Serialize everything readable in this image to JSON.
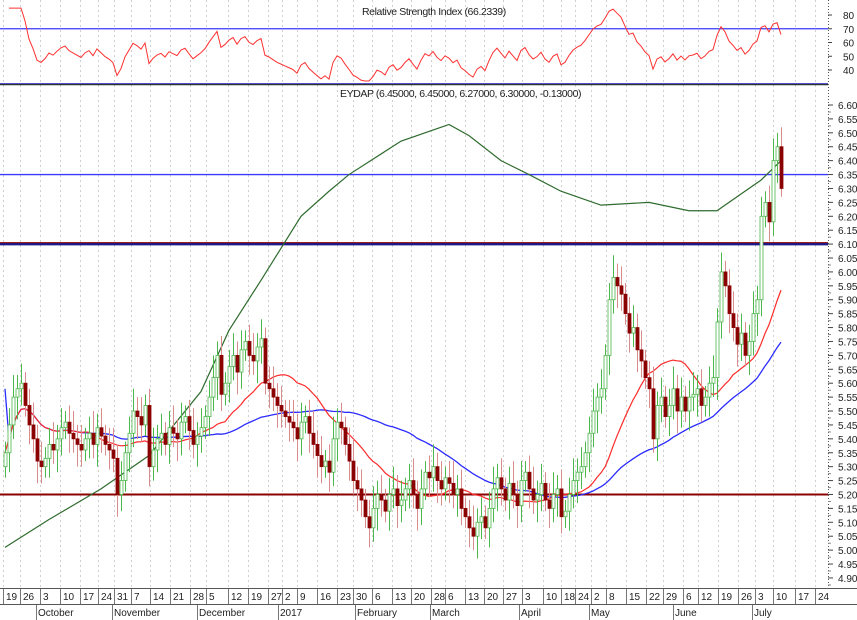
{
  "rsi_panel": {
    "title": "Relative Strength Index (66.2339)",
    "y_ticks": [
      "80",
      "70",
      "60",
      "50",
      "40"
    ]
  },
  "price_panel": {
    "title": "EYDAP (6.45000, 6.45000, 6.27000, 6.30000, -0.13000)"
  },
  "colors": {
    "up": "#4cb84c",
    "down": "#8b0000",
    "down_wick": "#d98c8c",
    "ma_short": "#ff2a2a",
    "ma_long": "#2b2bff",
    "long_line": "#2e6b2e",
    "resistance": "#3a3aff",
    "support": "#8b0000",
    "rsi": "#ff3030"
  },
  "chart_data": {
    "type": "candlestick",
    "symbol": "EYDAP",
    "title": "EYDAP (6.45000, 6.45000, 6.27000, 6.30000, -0.13000)",
    "last_bar": {
      "open": 6.45,
      "high": 6.45,
      "low": 6.27,
      "close": 6.3,
      "change": -0.13
    },
    "ylim": [
      4.9,
      6.6
    ],
    "y_ticks": [
      "6.60",
      "6.55",
      "6.50",
      "6.45",
      "6.40",
      "6.35",
      "6.30",
      "6.25",
      "6.20",
      "6.15",
      "6.10",
      "6.05",
      "6.00",
      "5.95",
      "5.90",
      "5.85",
      "5.80",
      "5.75",
      "5.70",
      "5.65",
      "5.60",
      "5.55",
      "5.50",
      "5.45",
      "5.40",
      "5.35",
      "5.30",
      "5.25",
      "5.20",
      "5.15",
      "5.10",
      "5.05",
      "5.00",
      "4.95",
      "4.90"
    ],
    "x_ticks": [
      "19",
      "26",
      "3",
      "10",
      "17",
      "24",
      "31",
      "7",
      "14",
      "21",
      "28",
      "5",
      "12",
      "19",
      "27",
      "2",
      "9",
      "16",
      "23",
      "30",
      "6",
      "13",
      "20",
      "28",
      "6",
      "13",
      "20",
      "27",
      "3",
      "10",
      "18",
      "24",
      "2",
      "8",
      "15",
      "22",
      "29",
      "6",
      "12",
      "19",
      "26",
      "3",
      "10",
      "17",
      "24"
    ],
    "months": [
      "October",
      "November",
      "December",
      "2017",
      "February",
      "March",
      "April",
      "May",
      "June",
      "July"
    ],
    "horizontal_lines": [
      {
        "value": 6.35,
        "color": "#3a3aff"
      },
      {
        "value": 6.1,
        "color": "#1a1a8b"
      },
      {
        "value": 5.2,
        "color": "#8b0000"
      }
    ],
    "rsi_levels": [
      70,
      30
    ],
    "rsi_ylim": [
      30,
      85
    ],
    "first_open": 5.3,
    "closes": [
      5.35,
      5.45,
      5.55,
      5.58,
      5.6,
      5.52,
      5.45,
      5.4,
      5.32,
      5.3,
      5.33,
      5.38,
      5.36,
      5.4,
      5.44,
      5.46,
      5.42,
      5.4,
      5.38,
      5.36,
      5.4,
      5.42,
      5.38,
      5.44,
      5.41,
      5.38,
      5.36,
      5.33,
      5.2,
      5.25,
      5.35,
      5.42,
      5.5,
      5.48,
      5.45,
      5.52,
      5.3,
      5.36,
      5.4,
      5.42,
      5.38,
      5.44,
      5.42,
      5.4,
      5.46,
      5.48,
      5.43,
      5.38,
      5.41,
      5.44,
      5.48,
      5.55,
      5.62,
      5.7,
      5.56,
      5.6,
      5.66,
      5.7,
      5.64,
      5.72,
      5.75,
      5.7,
      5.68,
      5.73,
      5.76,
      5.6,
      5.58,
      5.55,
      5.52,
      5.5,
      5.48,
      5.46,
      5.44,
      5.4,
      5.46,
      5.48,
      5.42,
      5.38,
      5.34,
      5.3,
      5.32,
      5.28,
      5.4,
      5.46,
      5.44,
      5.38,
      5.32,
      5.25,
      5.22,
      5.18,
      5.12,
      5.08,
      5.15,
      5.2,
      5.18,
      5.14,
      5.2,
      5.22,
      5.16,
      5.18,
      5.22,
      5.25,
      5.2,
      5.15,
      5.22,
      5.28,
      5.26,
      5.3,
      5.25,
      5.22,
      5.26,
      5.24,
      5.2,
      5.22,
      5.15,
      5.12,
      5.08,
      5.05,
      5.1,
      5.12,
      5.08,
      5.15,
      5.22,
      5.26,
      5.22,
      5.18,
      5.24,
      5.2,
      5.16,
      5.25,
      5.28,
      5.22,
      5.18,
      5.2,
      5.24,
      5.18,
      5.15,
      5.2,
      5.22,
      5.12,
      5.14,
      5.2,
      5.25,
      5.28,
      5.3,
      5.35,
      5.42,
      5.5,
      5.55,
      5.58,
      5.7,
      5.9,
      5.98,
      5.95,
      5.92,
      5.85,
      5.78,
      5.8,
      5.72,
      5.68,
      5.62,
      5.58,
      5.4,
      5.52,
      5.55,
      5.48,
      5.52,
      5.58,
      5.5,
      5.55,
      5.5,
      5.55,
      5.56,
      5.58,
      5.52,
      5.55,
      5.6,
      5.62,
      5.82,
      6.0,
      5.95,
      5.85,
      5.8,
      5.74,
      5.78,
      5.7,
      5.75,
      5.85,
      5.9,
      6.2,
      6.25,
      6.18,
      6.4,
      6.45,
      6.3
    ],
    "ma_periods": {
      "short": 20,
      "long": 50
    },
    "long_line_points": [
      [
        0,
        5.01
      ],
      [
        11,
        5.11
      ],
      [
        24,
        5.22
      ],
      [
        36,
        5.34
      ],
      [
        49,
        5.57
      ],
      [
        56,
        5.79
      ],
      [
        64,
        5.97
      ],
      [
        74,
        6.2
      ],
      [
        81,
        6.29
      ],
      [
        86,
        6.35
      ],
      [
        99,
        6.47
      ],
      [
        111,
        6.53
      ],
      [
        116,
        6.49
      ],
      [
        124,
        6.4
      ],
      [
        131,
        6.35
      ],
      [
        139,
        6.29
      ],
      [
        149,
        6.24
      ],
      [
        161,
        6.25
      ],
      [
        171,
        6.22
      ],
      [
        178,
        6.22
      ],
      [
        184,
        6.28
      ],
      [
        189,
        6.33
      ],
      [
        194,
        6.4
      ]
    ]
  }
}
